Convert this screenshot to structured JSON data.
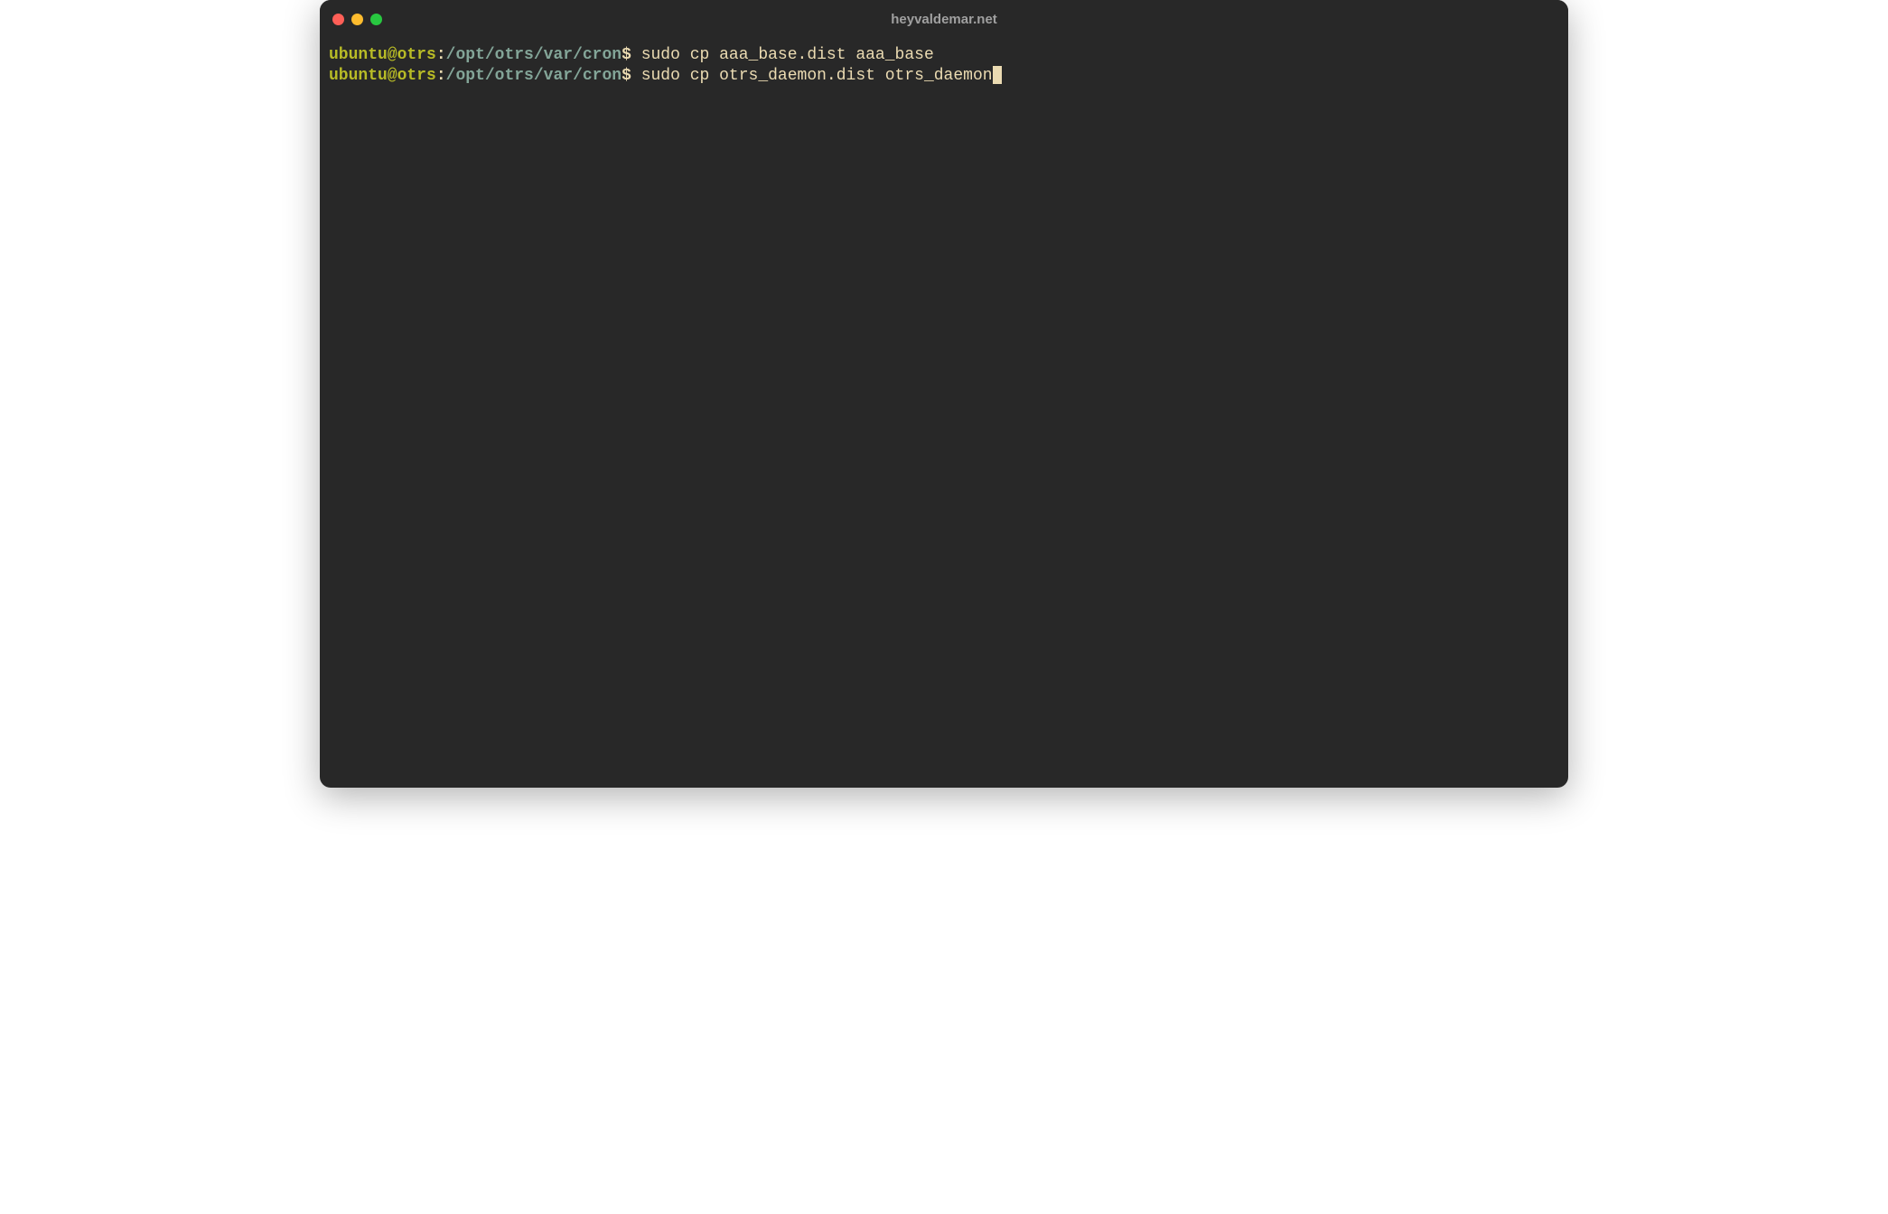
{
  "window": {
    "title": "heyvaldemar.net"
  },
  "colors": {
    "background": "#282828",
    "foreground": "#ebdbb2",
    "user_host": "#b8bb26",
    "path": "#83a598",
    "traffic_close": "#ff5f57",
    "traffic_minimize": "#febc2e",
    "traffic_zoom": "#28c840"
  },
  "lines": [
    {
      "user_host": "ubuntu@otrs",
      "colon": ":",
      "path": "/opt/otrs/var/cron",
      "prompt": "$",
      "command": " sudo cp aaa_base.dist aaa_base",
      "has_cursor": false
    },
    {
      "user_host": "ubuntu@otrs",
      "colon": ":",
      "path": "/opt/otrs/var/cron",
      "prompt": "$",
      "command": " sudo cp otrs_daemon.dist otrs_daemon",
      "has_cursor": true
    }
  ]
}
